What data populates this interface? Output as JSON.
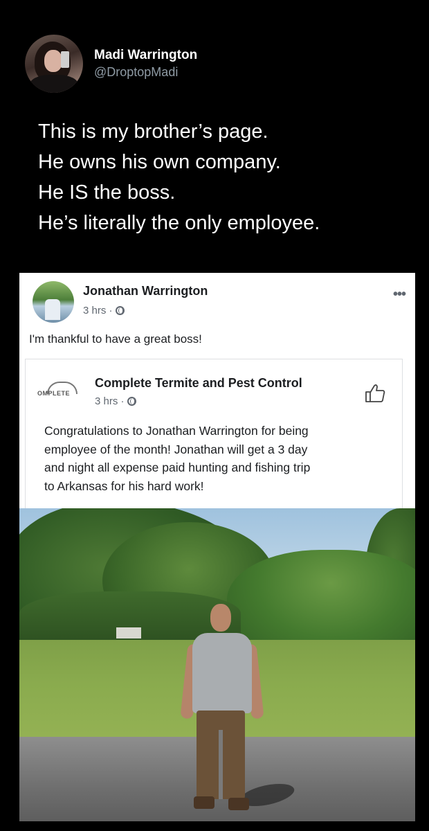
{
  "tweet": {
    "display_name": "Madi Warrington",
    "handle": "@DroptopMadi",
    "lines": [
      "This is my brother’s page.",
      "He owns his own company.",
      "He IS the boss.",
      "He’s literally the only employee."
    ]
  },
  "fb_post": {
    "author": "Jonathan Warrington",
    "time": "3 hrs ·",
    "text": "I'm thankful to have a great boss!",
    "shared_post": {
      "page_name": "Complete Termite and Pest Control",
      "logo_text": "OMPLETE",
      "time": "3 hrs ·",
      "lines": [
        "Congratulations to Jonathan Warrington for being",
        "employee of the month! Jonathan will get a 3 day",
        "and night all expense paid hunting and fishing trip",
        "to Arkansas for his hard work!"
      ]
    }
  },
  "icons": {
    "globe": "globe-icon",
    "more": "more-options-icon",
    "like": "thumbs-up-icon"
  }
}
